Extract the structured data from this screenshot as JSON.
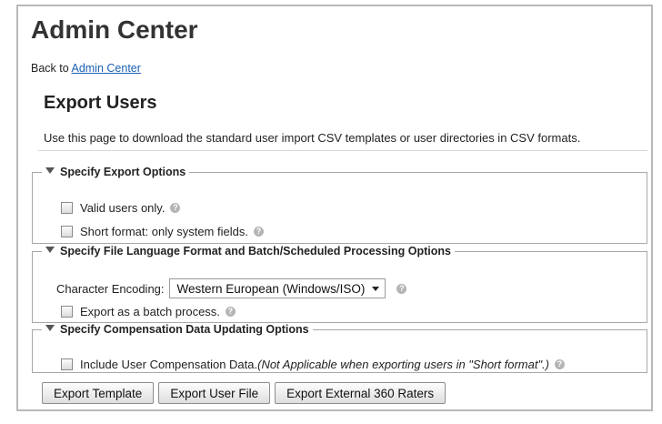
{
  "header": {
    "title": "Admin Center"
  },
  "back_link": {
    "prefix": "Back to",
    "link_text": "Admin Center"
  },
  "page": {
    "title": "Export Users",
    "description": "Use this page to download the standard user import CSV templates or user directories in CSV formats."
  },
  "sections": {
    "export_options": {
      "legend": "Specify Export Options",
      "valid_users": "Valid users only.",
      "short_format": "Short format: only system fields."
    },
    "language_format": {
      "legend": "Specify File Language Format and Batch/Scheduled Processing Options",
      "encoding_label": "Character Encoding:",
      "encoding_value": "Western European (Windows/ISO)",
      "batch_process": "Export as a batch process."
    },
    "compensation": {
      "legend": "Specify Compensation Data Updating Options",
      "include_label": "Include User Compensation Data.",
      "include_note": "(Not Applicable when exporting users in \"Short format\".)"
    }
  },
  "buttons": {
    "export_template": "Export Template",
    "export_user_file": "Export User File",
    "export_360_raters": "Export External 360 Raters"
  },
  "icons": {
    "help": "help-icon",
    "collapse": "triangle-down-icon",
    "dropdown": "chevron-down-icon"
  },
  "colors": {
    "link": "#1a5fb4",
    "border": "#a8a8a8"
  }
}
